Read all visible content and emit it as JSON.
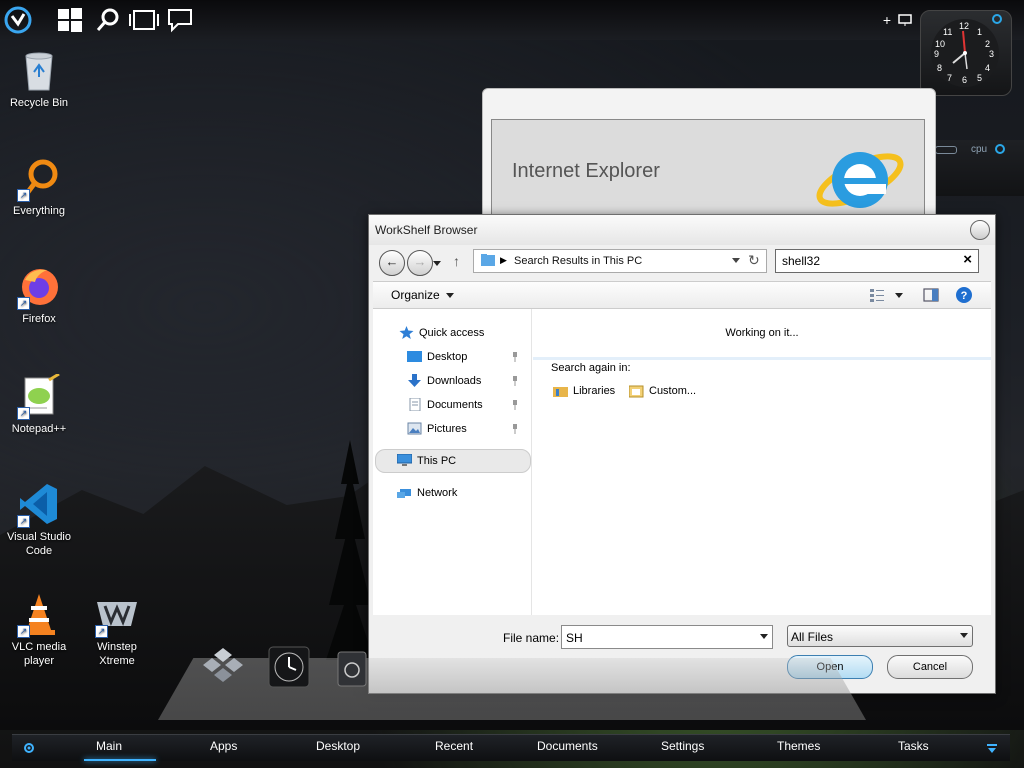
{
  "desktop_icons": [
    {
      "label": "Recycle Bin",
      "icon": "recycle-bin-icon"
    },
    {
      "label": "Everything",
      "icon": "search-magnifier-icon"
    },
    {
      "label": "Firefox",
      "icon": "firefox-icon"
    },
    {
      "label": "Notepad++",
      "icon": "notepad-plus-plus-icon"
    },
    {
      "label": "Visual Studio Code",
      "icon": "vscode-icon"
    },
    {
      "label": "VLC media player",
      "icon": "vlc-cone-icon"
    },
    {
      "label": "Winstep Xtreme",
      "icon": "winstep-icon"
    }
  ],
  "clock": {
    "numbers": [
      "12",
      "1",
      "2",
      "3",
      "4",
      "5",
      "6",
      "7",
      "8",
      "9",
      "10",
      "11"
    ]
  },
  "cpu_gadget": {
    "label": "cpu"
  },
  "ie_window": {
    "title": "Internet Explorer"
  },
  "dialog": {
    "title": "WorkShelf Browser",
    "address_text": "Search Results in This PC",
    "search_value": "shell32",
    "organize_label": "Organize",
    "nav_items": [
      {
        "label": "Quick access",
        "icon": "star-icon"
      },
      {
        "label": "Desktop",
        "icon": "desktop-folder-icon"
      },
      {
        "label": "Downloads",
        "icon": "download-arrow-icon"
      },
      {
        "label": "Documents",
        "icon": "document-icon"
      },
      {
        "label": "Pictures",
        "icon": "pictures-icon"
      },
      {
        "label": "This PC",
        "icon": "computer-icon"
      },
      {
        "label": "Network",
        "icon": "network-icon"
      }
    ],
    "working_text": "Working on it...",
    "search_again_label": "Search again in:",
    "search_again_links": [
      "Libraries",
      "Custom..."
    ],
    "file_name_label": "File name:",
    "file_name_value": "SH",
    "file_type_value": "All Files",
    "open_label": "Open",
    "cancel_label": "Cancel"
  },
  "taskbar": {
    "tabs": [
      "Main",
      "Apps",
      "Desktop",
      "Recent",
      "Documents",
      "Settings",
      "Themes",
      "Tasks"
    ],
    "active": "Main"
  },
  "colors": {
    "accent": "#3fb3ff",
    "dialog_bg": "#f0f0f0",
    "open_button": "#b3dcf3"
  }
}
